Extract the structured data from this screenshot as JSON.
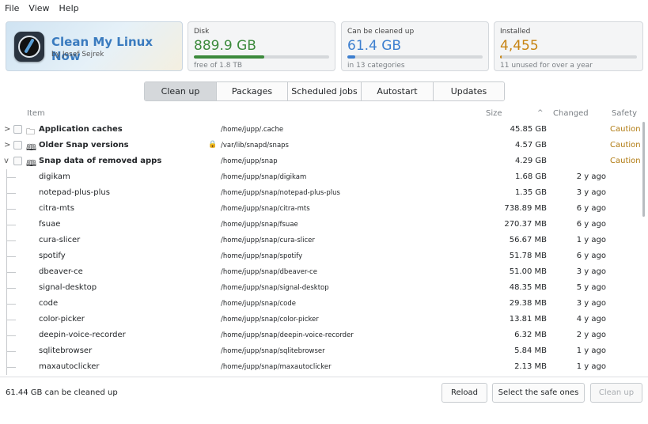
{
  "menu": {
    "file": "File",
    "view": "View",
    "help": "Help"
  },
  "logo": {
    "title": "Clean My Linux Now",
    "author": "by Josef Sejrek"
  },
  "cards": {
    "disk": {
      "label": "Disk",
      "value": "889.9 GB",
      "sub": "free of 1.8 TB",
      "fraction": 0.52,
      "color": "#3c8a3c"
    },
    "clean": {
      "label": "Can be cleaned up",
      "value": "61.4 GB",
      "sub": "in 13 categories",
      "fraction": 0.06,
      "color": "#3d7fcf"
    },
    "installed": {
      "label": "Installed",
      "value": "4,455",
      "sub": "11 unused for over a year",
      "fraction": 0.01,
      "color": "#c78412"
    }
  },
  "tabs": [
    "Clean up",
    "Packages",
    "Scheduled jobs",
    "Autostart",
    "Updates"
  ],
  "columns": {
    "item": "Item",
    "size": "Size",
    "changed": "Changed",
    "safety": "Safety",
    "sort_icon": "^"
  },
  "rows": [
    {
      "expander": ">",
      "icon": "🗀",
      "name": "Application caches",
      "path": "/home/jupp/.cache",
      "size": "45.85 GB",
      "changed": "",
      "safety": "Caution",
      "lock": ""
    },
    {
      "expander": ">",
      "icon": "🕮",
      "name": "Older Snap versions",
      "path": "/var/lib/snapd/snaps",
      "size": "4.57 GB",
      "changed": "",
      "safety": "Caution",
      "lock": "🔒"
    },
    {
      "expander": "v",
      "icon": "🕮",
      "name": "Snap data of removed apps",
      "path": "/home/jupp/snap",
      "size": "4.29 GB",
      "changed": "",
      "safety": "Caution",
      "lock": ""
    }
  ],
  "children": [
    {
      "name": "digikam",
      "path": "/home/jupp/snap/digikam",
      "size": "1.68 GB",
      "changed": "2 y ago"
    },
    {
      "name": "notepad-plus-plus",
      "path": "/home/jupp/snap/notepad-plus-plus",
      "size": "1.35 GB",
      "changed": "3 y ago"
    },
    {
      "name": "citra-mts",
      "path": "/home/jupp/snap/citra-mts",
      "size": "738.89 MB",
      "changed": "6 y ago"
    },
    {
      "name": "fsuae",
      "path": "/home/jupp/snap/fsuae",
      "size": "270.37 MB",
      "changed": "6 y ago"
    },
    {
      "name": "cura-slicer",
      "path": "/home/jupp/snap/cura-slicer",
      "size": "56.67 MB",
      "changed": "1 y ago"
    },
    {
      "name": "spotify",
      "path": "/home/jupp/snap/spotify",
      "size": "51.78 MB",
      "changed": "6 y ago"
    },
    {
      "name": "dbeaver-ce",
      "path": "/home/jupp/snap/dbeaver-ce",
      "size": "51.00 MB",
      "changed": "3 y ago"
    },
    {
      "name": "signal-desktop",
      "path": "/home/jupp/snap/signal-desktop",
      "size": "48.35 MB",
      "changed": "5 y ago"
    },
    {
      "name": "code",
      "path": "/home/jupp/snap/code",
      "size": "29.38 MB",
      "changed": "3 y ago"
    },
    {
      "name": "color-picker",
      "path": "/home/jupp/snap/color-picker",
      "size": "13.81 MB",
      "changed": "4 y ago"
    },
    {
      "name": "deepin-voice-recorder",
      "path": "/home/jupp/snap/deepin-voice-recorder",
      "size": "6.32 MB",
      "changed": "2 y ago"
    },
    {
      "name": "sqlitebrowser",
      "path": "/home/jupp/snap/sqlitebrowser",
      "size": "5.84 MB",
      "changed": "1 y ago"
    },
    {
      "name": "maxautoclicker",
      "path": "/home/jupp/snap/maxautoclicker",
      "size": "2.13 MB",
      "changed": "1 y ago"
    }
  ],
  "status": {
    "text": "61.44 GB can be cleaned up",
    "reload": "Reload",
    "select_safe": "Select the safe ones",
    "clean_up": "Clean up"
  }
}
